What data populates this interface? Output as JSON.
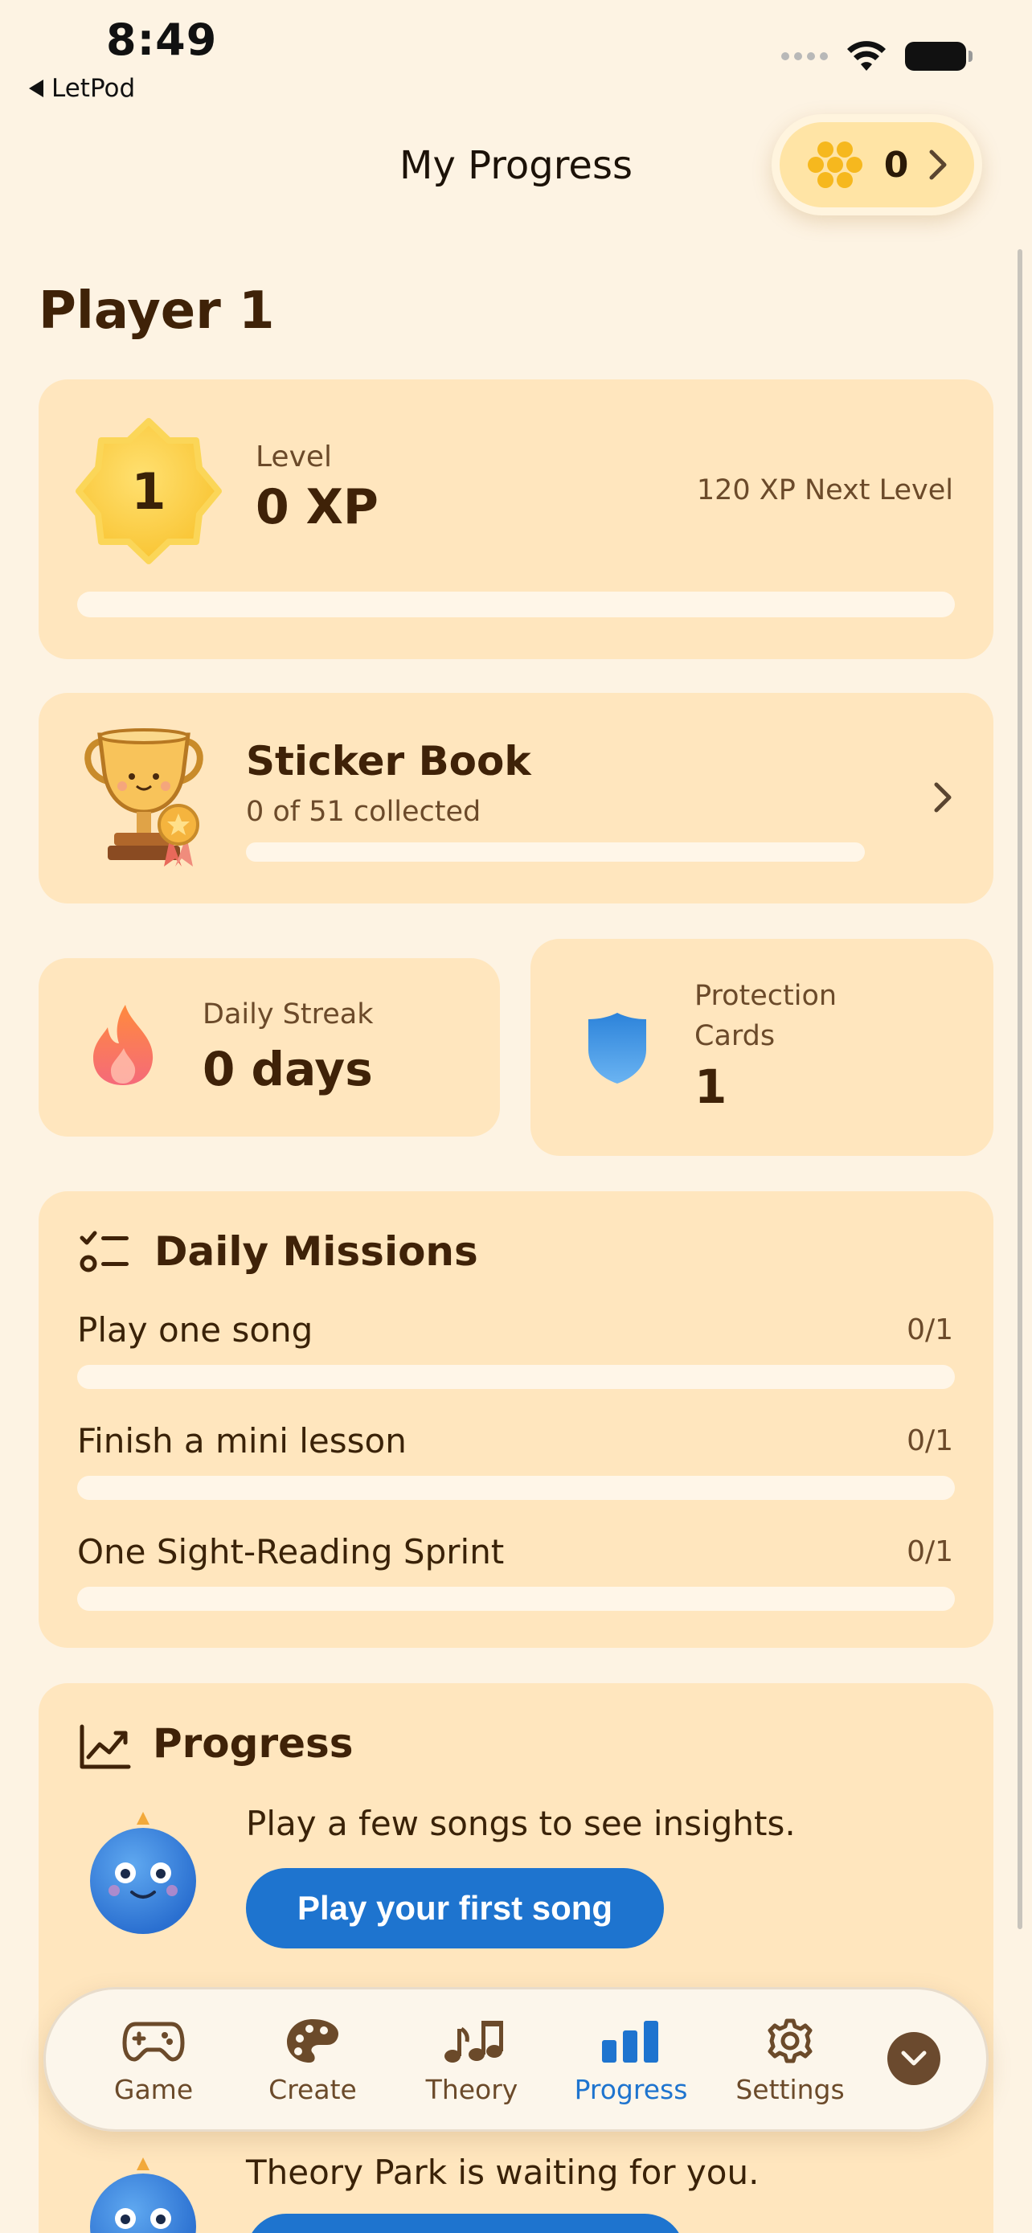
{
  "status_bar": {
    "time": "8:49",
    "back_app": "LetPod"
  },
  "header": {
    "title": "My Progress",
    "coin_count": "0"
  },
  "player": {
    "name": "Player 1"
  },
  "level": {
    "number": "1",
    "label": "Level",
    "xp": "0 XP",
    "next_level": "120 XP Next Level",
    "progress_fraction": 0
  },
  "sticker_book": {
    "title": "Sticker Book",
    "subtitle": "0 of 51 collected",
    "progress_fraction": 0
  },
  "streak": {
    "label": "Daily Streak",
    "value": "0 days"
  },
  "protection": {
    "label": "Protection Cards",
    "value": "1"
  },
  "missions": {
    "title": "Daily Missions",
    "items": [
      {
        "label": "Play one song",
        "count": "0/1",
        "progress_fraction": 0
      },
      {
        "label": "Finish a mini lesson",
        "count": "0/1",
        "progress_fraction": 0
      },
      {
        "label": "One Sight-Reading Sprint",
        "count": "0/1",
        "progress_fraction": 0
      }
    ]
  },
  "progress": {
    "title": "Progress",
    "insight": "Play a few songs to see insights.",
    "cta": "Play your first song",
    "next_text": "Theory Park is waiting for you."
  },
  "tabbar": {
    "tabs": [
      {
        "label": "Game",
        "icon": "gamepad-icon"
      },
      {
        "label": "Create",
        "icon": "palette-icon"
      },
      {
        "label": "Theory",
        "icon": "music-notes-icon"
      },
      {
        "label": "Progress",
        "icon": "bar-chart-icon"
      },
      {
        "label": "Settings",
        "icon": "gear-icon"
      }
    ],
    "active": "Progress"
  },
  "colors": {
    "background": "#FDF3E3",
    "card": "#FFE6BE",
    "accent_blue": "#1E74CF",
    "text_dark": "#3F2208",
    "badge_gold": "#FFD04D"
  }
}
